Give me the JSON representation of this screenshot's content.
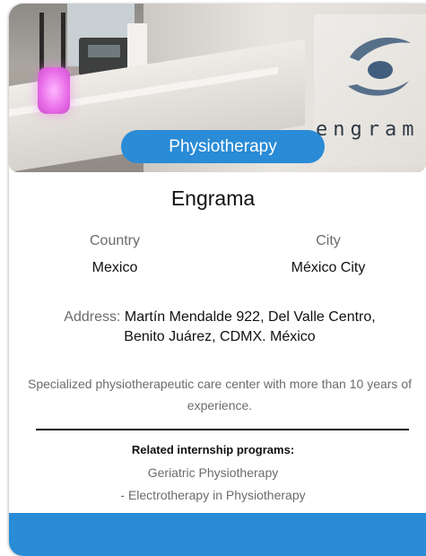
{
  "card": {
    "category": "Physiotherapy",
    "logo_text": "engram",
    "name": "Engrama",
    "country_label": "Country",
    "country_value": "Mexico",
    "city_label": "City",
    "city_value": "México City",
    "address_label": "Address:",
    "address_value": "Martín Mendalde 922, Del Valle Centro, Benito Juárez, CDMX. México",
    "description": "Specialized physiotherapeutic care center with more than 10 years of experience.",
    "programs_title": "Related internship programs:",
    "programs": [
      "Geriatric Physiotherapy",
      "- Electrotherapy in Physiotherapy"
    ]
  },
  "colors": {
    "accent": "#2a8bd6",
    "text_primary": "#111111",
    "text_secondary": "#6c6c6c"
  }
}
